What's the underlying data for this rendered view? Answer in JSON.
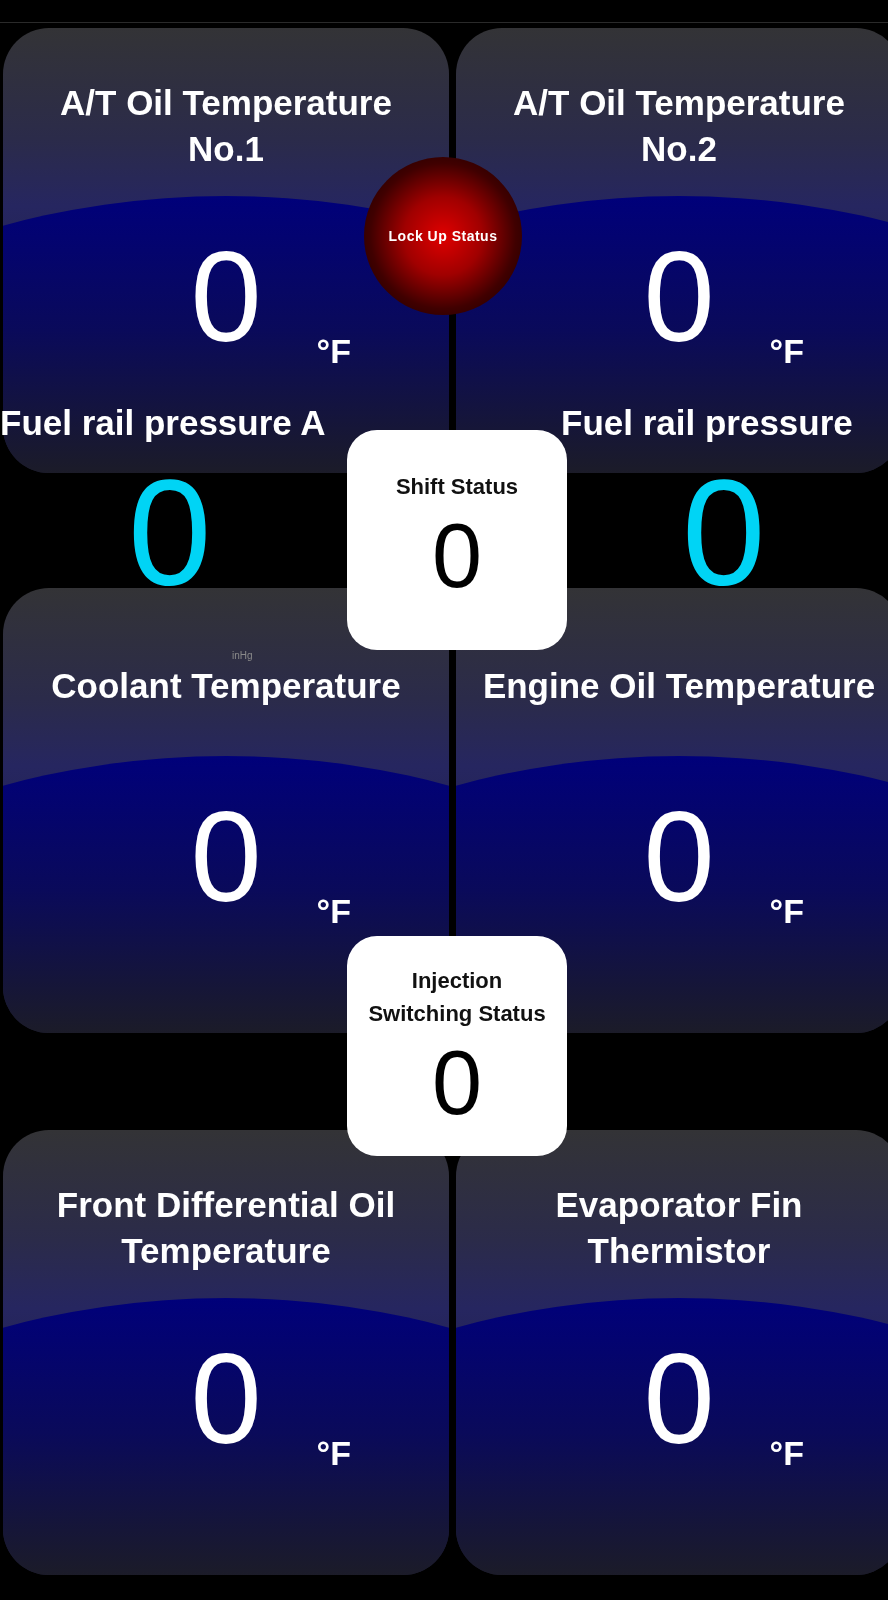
{
  "gauges": [
    {
      "title": "A/T Oil Temperature No.1",
      "value": "0",
      "unit": "°F"
    },
    {
      "title": "A/T Oil Temperature No.2",
      "value": "0",
      "unit": "°F"
    },
    {
      "title": "Coolant Temperature",
      "value": "0",
      "unit": "°F"
    },
    {
      "title": "Engine Oil Temperature",
      "value": "0",
      "unit": "°F"
    },
    {
      "title": "Front Differential Oil Temperature",
      "value": "0",
      "unit": "°F"
    },
    {
      "title": "Evaporator Fin Thermistor",
      "value": "0",
      "unit": "°F"
    }
  ],
  "fuel_rail": [
    {
      "label": "Fuel rail pressure A",
      "value": "0"
    },
    {
      "label": "Fuel rail pressure",
      "value": "0"
    }
  ],
  "lock_up": {
    "label": "Lock Up Status"
  },
  "status_boxes": [
    {
      "label_lines": [
        "Shift Status"
      ],
      "value": "0"
    },
    {
      "label_lines": [
        "Injection",
        "Switching Status"
      ],
      "value": "0"
    }
  ],
  "stray_unit": "inHg"
}
